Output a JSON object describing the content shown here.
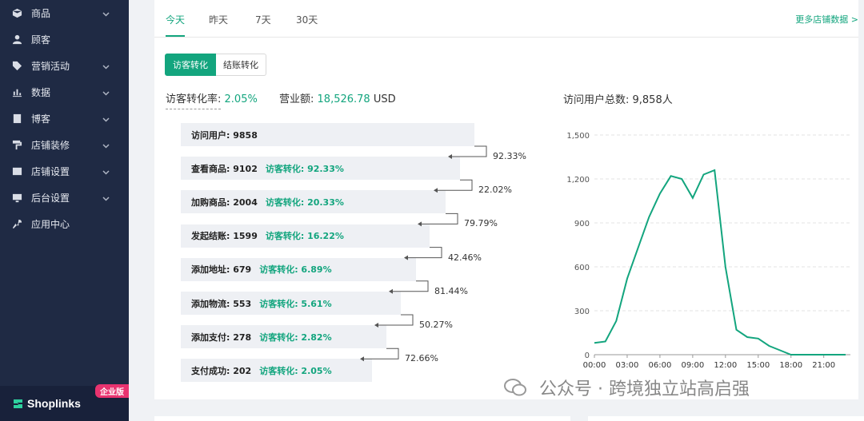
{
  "sidebar": {
    "items": [
      {
        "label": "商品",
        "icon": "box-icon",
        "chev": true
      },
      {
        "label": "顾客",
        "icon": "user-icon",
        "chev": false
      },
      {
        "label": "营销活动",
        "icon": "tag-icon",
        "chev": true
      },
      {
        "label": "数据",
        "icon": "bar-chart-icon",
        "chev": true
      },
      {
        "label": "博客",
        "icon": "blog-icon",
        "chev": true
      },
      {
        "label": "店铺装修",
        "icon": "paint-roller-icon",
        "chev": true
      },
      {
        "label": "店铺设置",
        "icon": "store-settings-icon",
        "chev": true
      },
      {
        "label": "后台设置",
        "icon": "admin-settings-icon",
        "chev": true
      },
      {
        "label": "应用中心",
        "icon": "wrench-icon",
        "chev": false
      }
    ],
    "brand": "Shoplinks",
    "badge": "企业版"
  },
  "tabs": [
    "今天",
    "昨天",
    "7天",
    "30天"
  ],
  "more_link": "更多店铺数据 >",
  "segment": {
    "on": "访客转化",
    "off": "结账转化"
  },
  "stats": {
    "rate_label": "访客转化率:",
    "rate_value": "2.05%",
    "revenue_label": "营业额:",
    "revenue_value": "18,526.78",
    "revenue_unit": "USD",
    "users_total": "访问用户总数: 9,858人"
  },
  "funnel": [
    {
      "label": "访问用户: 9858",
      "conv": ""
    },
    {
      "label": "查看商品: 9102",
      "conv": "访客转化: 92.33%"
    },
    {
      "label": "加购商品: 2004",
      "conv": "访客转化: 20.33%"
    },
    {
      "label": "发起结账: 1599",
      "conv": "访客转化: 16.22%"
    },
    {
      "label": "添加地址: 679",
      "conv": "访客转化: 6.89%"
    },
    {
      "label": "添加物流: 553",
      "conv": "访客转化: 5.61%"
    },
    {
      "label": "添加支付: 278",
      "conv": "访客转化: 2.82%"
    },
    {
      "label": "支付成功: 202",
      "conv": "访客转化: 2.05%"
    }
  ],
  "step_rates": [
    "92.33%",
    "22.02%",
    "79.79%",
    "42.46%",
    "81.44%",
    "50.27%",
    "72.66%"
  ],
  "watermark": "公众号 · 跨境独立站高启强",
  "colors": {
    "accent": "#13a57e",
    "sidebar": "#1f2a44",
    "badge": "#e8336f"
  },
  "chart_data": {
    "type": "line",
    "title": "",
    "xlabel": "",
    "ylabel": "",
    "x_ticks": [
      "00:00",
      "03:00",
      "06:00",
      "09:00",
      "12:00",
      "15:00",
      "18:00",
      "21:00"
    ],
    "y_ticks": [
      "0",
      "300",
      "600",
      "900",
      "1,200",
      "1,500"
    ],
    "ylim": [
      0,
      1500
    ],
    "x": [
      0,
      1,
      2,
      3,
      4,
      5,
      6,
      7,
      8,
      9,
      10,
      11,
      12,
      13,
      14,
      15,
      16,
      17,
      18,
      19,
      20,
      21,
      22,
      23
    ],
    "series": [
      {
        "values": [
          80,
          90,
          230,
          520,
          730,
          940,
          1100,
          1220,
          1200,
          1070,
          1230,
          1260,
          600,
          170,
          120,
          110,
          60,
          30,
          0,
          0,
          0,
          0,
          0,
          0
        ]
      }
    ],
    "grid": true,
    "line_color": "#13a57e"
  }
}
